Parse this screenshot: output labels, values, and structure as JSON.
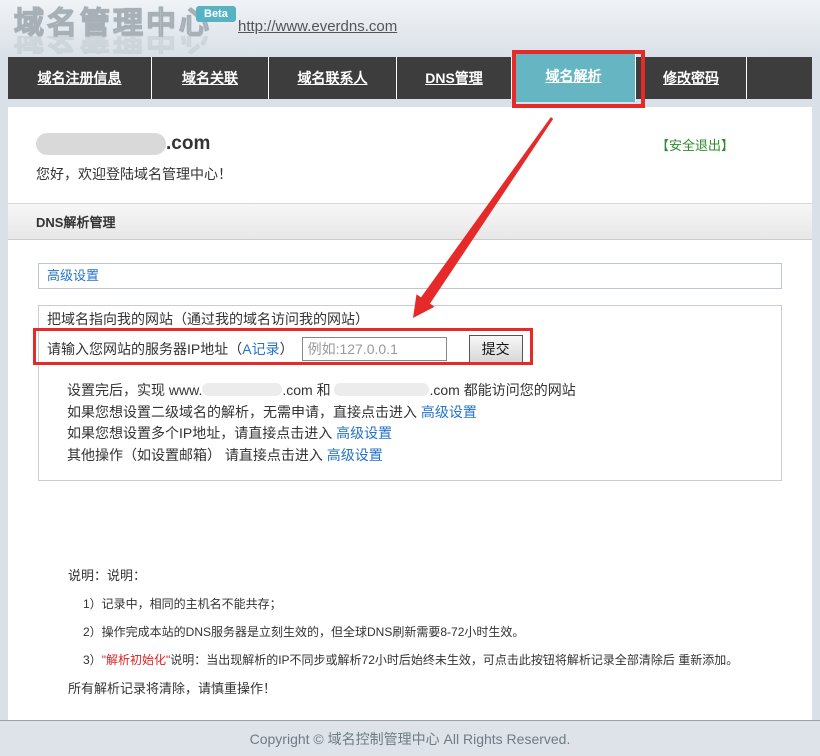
{
  "colors": {
    "accent_teal": "#65b6c2",
    "annotation_red": "#e62a2a",
    "link_blue": "#2572cc",
    "logout_green": "#2e8b2e",
    "nav_dark": "#3d3d3d"
  },
  "header": {
    "logo_text": "域名管理中心",
    "beta_badge": "Beta",
    "site_url": "http://www.everdns.com"
  },
  "nav": {
    "items": [
      {
        "label": "域名注册信息",
        "active": false
      },
      {
        "label": "域名关联",
        "active": false
      },
      {
        "label": "域名联系人",
        "active": false
      },
      {
        "label": "DNS管理",
        "active": false
      },
      {
        "label": "域名解析",
        "active": true
      },
      {
        "label": "修改密码",
        "active": false
      }
    ]
  },
  "welcome": {
    "domain_suffix": ".com",
    "greeting": "您好，欢迎登陆域名管理中心！",
    "logout_label": "【安全退出】"
  },
  "section": {
    "title": "DNS解析管理"
  },
  "advanced": {
    "link_label": "高级设置"
  },
  "form": {
    "heading": "把域名指向我的网站（通过我的域名访问我的网站）",
    "ip_label_prefix": "请输入您网站的服务器IP地址（",
    "ip_label_link": "A记录",
    "ip_label_suffix": "）",
    "ip_placeholder": "例如:127.0.0.1",
    "submit_label": "提交"
  },
  "instructions": {
    "line1_prefix": "设置完后，实现 www.",
    "line1_mid": ".com 和",
    "line1_suffix": ".com 都能访问您的网站",
    "line2_text": "如果您想设置二级域名的解析，无需申请，直接点击进入",
    "line3_text": "如果您想设置多个IP地址，请直接点击进入",
    "line4_text": "其他操作（如设置邮箱） 请直接点击进入",
    "advanced_link": "高级设置"
  },
  "notes": {
    "heading": "说明：说明：",
    "item1": "1）记录中，相同的主机名不能共存；",
    "item2": "2）操作完成本站的DNS服务器是立刻生效的，但全球DNS刷新需要8-72小时生效。",
    "item3_prefix": "3）",
    "item3_highlight": "\"解析初始化\"",
    "item3_suffix": "说明：当出现解析的IP不同步或解析72小时后始终未生效，可点击此按钮将解析记录全部清除后 重新添加。",
    "warning": "所有解析记录将清除，请慎重操作！"
  },
  "footer": {
    "copyright": "Copyright © 域名控制管理中心 All Rights Reserved."
  }
}
